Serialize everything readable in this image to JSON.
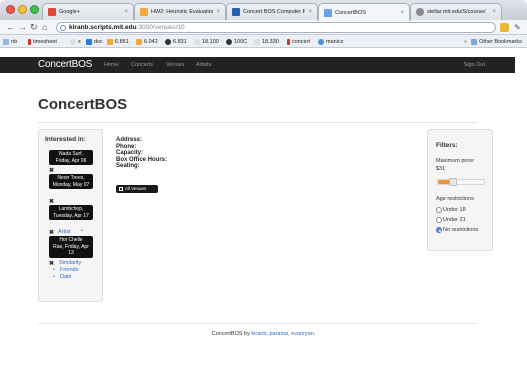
{
  "browser": {
    "tabs": [
      {
        "label": "Google+",
        "favicon_color": "#dd4b39"
      },
      {
        "label": "HW2: Heuristic Evaluation",
        "favicon_color": "#f3a83b"
      },
      {
        "label": "Concert BOS Computer Pr",
        "favicon_color": "#2b5fb3"
      },
      {
        "label": "ConcertBOS",
        "favicon_color": "#6aa0e6"
      },
      {
        "label": "stellar.mit.edu/S/course/",
        "favicon_color": "#8a8a8a"
      }
    ],
    "url_host": "kiranb.scripts.mit.edu",
    "url_path": ":3000/venues/10",
    "bookmarks": [
      {
        "label": "nb"
      },
      {
        "label": "timesheet"
      },
      {
        "label": "x"
      },
      {
        "label": "doc"
      },
      {
        "label": "6.851"
      },
      {
        "label": "6.042"
      },
      {
        "label": "6.831"
      },
      {
        "label": "18.100"
      },
      {
        "label": "100C"
      },
      {
        "label": "18.330"
      },
      {
        "label": "concert"
      },
      {
        "label": "manicz"
      }
    ],
    "other_bookmarks": "Other Bookmarks"
  },
  "site": {
    "brand": "ConcertBOS",
    "nav": [
      "Home",
      "Concerts",
      "Venues",
      "Artists"
    ],
    "sign_out": "Sign Out"
  },
  "main": {
    "heading": "ConcertBOS",
    "info_labels": [
      "Address:",
      "Phone:",
      "Capacity:",
      "Box Office Hours:",
      "Seating:"
    ],
    "all_venues_button": "All Venues"
  },
  "interested": {
    "title": "Interested in:",
    "events": [
      {
        "line1": "Nada Surf,",
        "line2": "Friday, Apr 06"
      },
      {
        "line1": "Neon Trees,",
        "line2": "Monday, May 07"
      },
      {
        "line1": "Lambchop,",
        "line2": "Tuesday, Apr 17"
      },
      {
        "line1": "Hot Chelle",
        "line2": "Rae, Friday, Apr 13"
      }
    ],
    "x_mark": "✖",
    "artist_link": "Artist",
    "similarity_link": "Similarity",
    "friends_link": "Friends",
    "date_link": "Date"
  },
  "filters": {
    "title": "Filters:",
    "max_price_label": "Maximum price:",
    "max_price_value": "$31",
    "price_slider_fraction": 0.25,
    "age_label": "Age restrictions",
    "options": [
      "Under 18",
      "Under 21",
      "No restrictions"
    ],
    "selected_option": "No restrictions"
  },
  "footer": {
    "prefix": "ConcertBOS by",
    "author1": "kiranb",
    "sep1": ",",
    "author2": "parama",
    "sep2": ",",
    "author3": "evanryan",
    "suffix": "."
  }
}
